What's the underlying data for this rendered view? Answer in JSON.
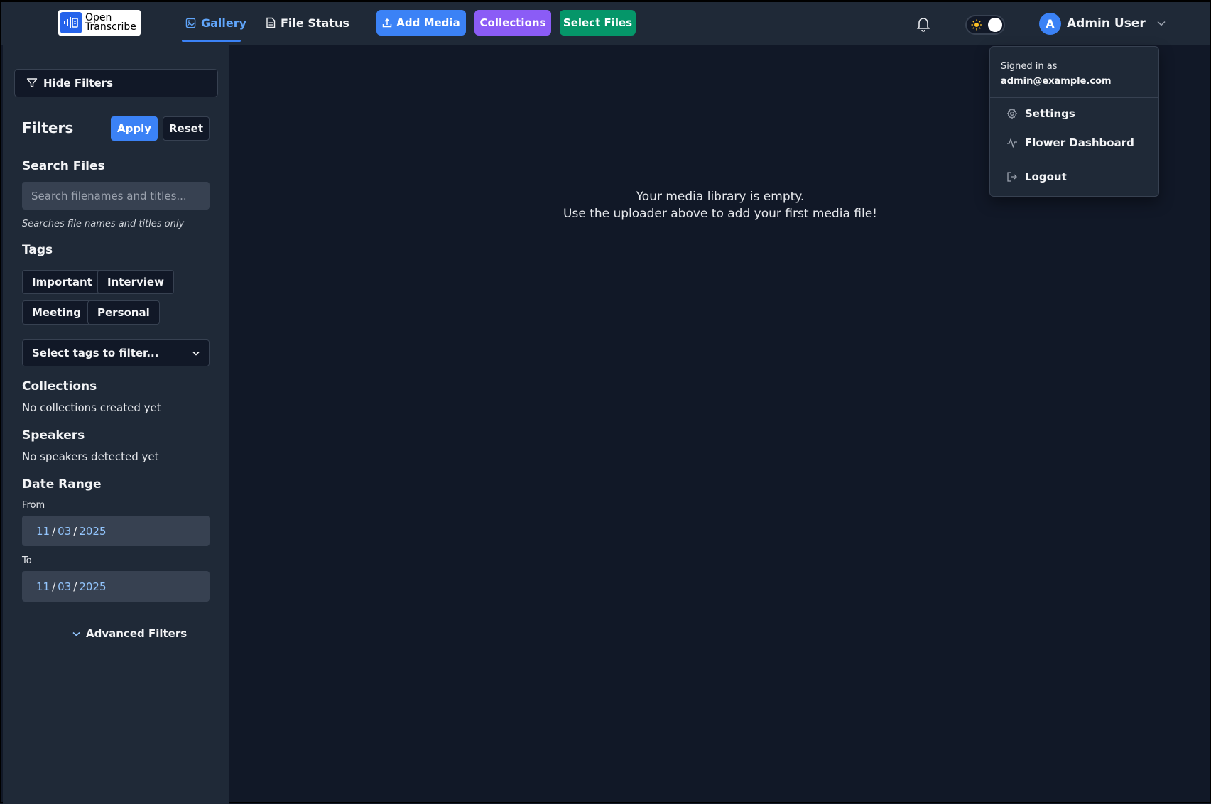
{
  "app": {
    "logo_line1": "Open",
    "logo_line2": "Transcribe"
  },
  "nav": {
    "gallery_label": "Gallery",
    "file_status_label": "File Status"
  },
  "toolbar": {
    "add_media_label": "Add Media",
    "collections_label": "Collections",
    "select_files_label": "Select Files"
  },
  "user": {
    "initial": "A",
    "name": "Admin User"
  },
  "user_menu": {
    "signed_in_label": "Signed in as",
    "email": "admin@example.com",
    "settings_label": "Settings",
    "flower_label": "Flower Dashboard",
    "logout_label": "Logout"
  },
  "sidebar": {
    "hide_filters_label": "Hide Filters",
    "filters_title": "Filters",
    "apply_label": "Apply",
    "reset_label": "Reset",
    "search_title": "Search Files",
    "search_placeholder": "Search filenames and titles...",
    "search_hint": "Searches file names and titles only",
    "tags_title": "Tags",
    "tags": [
      "Important",
      "Interview",
      "Meeting",
      "Personal"
    ],
    "tag_select_placeholder": "Select tags to filter...",
    "collections_title": "Collections",
    "collections_empty": "No collections created yet",
    "speakers_title": "Speakers",
    "speakers_empty": "No speakers detected yet",
    "date_range_title": "Date Range",
    "from_label": "From",
    "from_date": {
      "month": "11",
      "day": "03",
      "year": "2025"
    },
    "to_label": "To",
    "to_date": {
      "month": "11",
      "day": "03",
      "year": "2025"
    },
    "advanced_filters_label": "Advanced Filters"
  },
  "main": {
    "empty_line1": "Your media library is empty.",
    "empty_line2": "Use the uploader above to add your first media file!"
  },
  "colors": {
    "background": "#111827",
    "panel": "#1f2937",
    "primary": "#3b82f6",
    "collections": "#8b5cf6",
    "select_files": "#059669"
  }
}
